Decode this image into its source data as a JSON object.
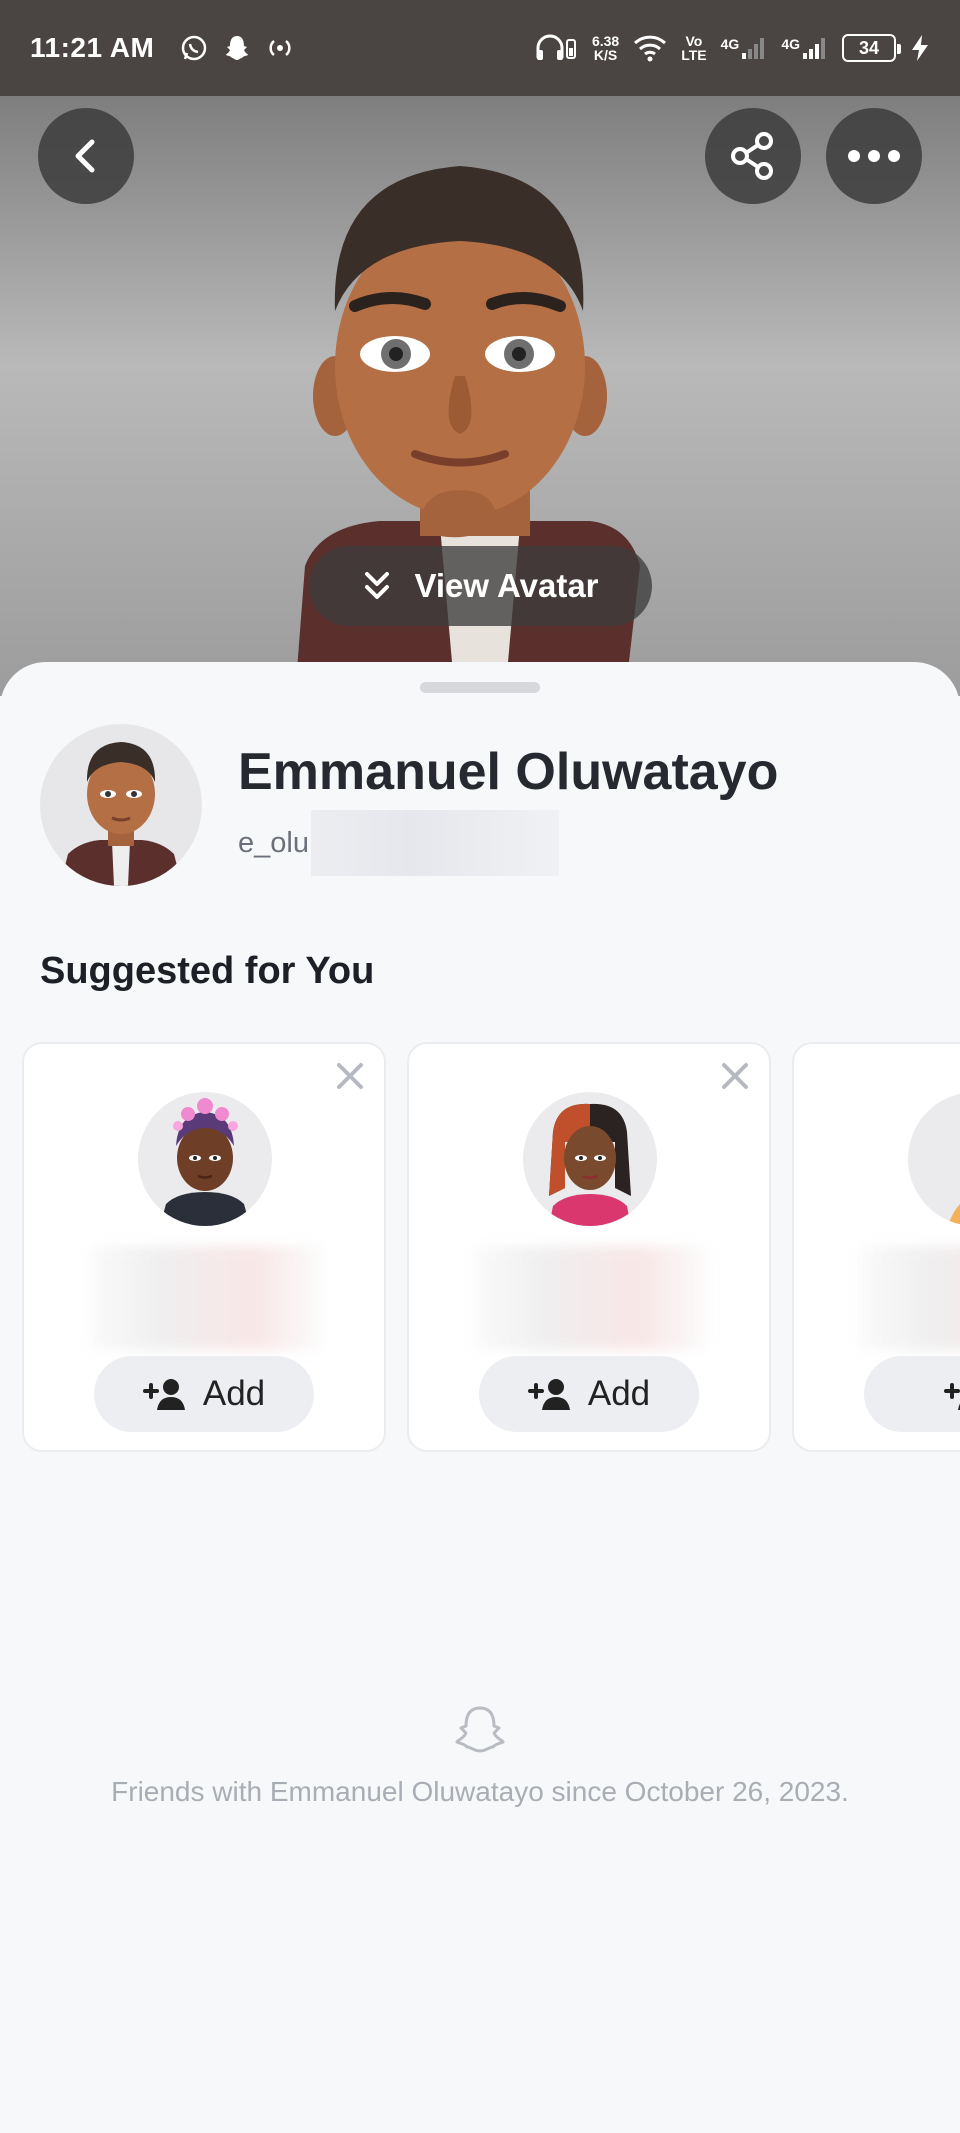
{
  "status_bar": {
    "time": "11:21 AM",
    "net_speed_value": "6.38",
    "net_speed_unit": "K/S",
    "volte_top": "Vo",
    "volte_bottom": "LTE",
    "signal1_label": "4G",
    "signal2_label": "4G",
    "battery": "34"
  },
  "hero": {
    "view_avatar_label": "View Avatar"
  },
  "profile": {
    "display_name": "Emmanuel Oluwatayo",
    "username_partial": "e_olu"
  },
  "suggested": {
    "title": "Suggested for You",
    "add_label": "Add",
    "cards": [
      {
        "add_label": "Add"
      },
      {
        "add_label": "Add"
      },
      {
        "add_label": ""
      }
    ]
  },
  "friendship": {
    "text": "Friends with Emmanuel Oluwatayo since October 26, 2023."
  },
  "colors": {
    "status_bar_bg": "#4a4542",
    "sheet_bg": "#f7f8f9",
    "button_bg": "#eceef1",
    "muted_text": "#a9adb4"
  },
  "icons": [
    "whatsapp-icon",
    "snapchat-icon",
    "hotspot-icon",
    "headphones-icon",
    "wifi-icon",
    "signal-icon",
    "charging-icon",
    "back-icon",
    "share-icon",
    "more-icon",
    "chevron-double-down-icon",
    "close-icon",
    "add-friend-icon",
    "ghost-icon"
  ]
}
